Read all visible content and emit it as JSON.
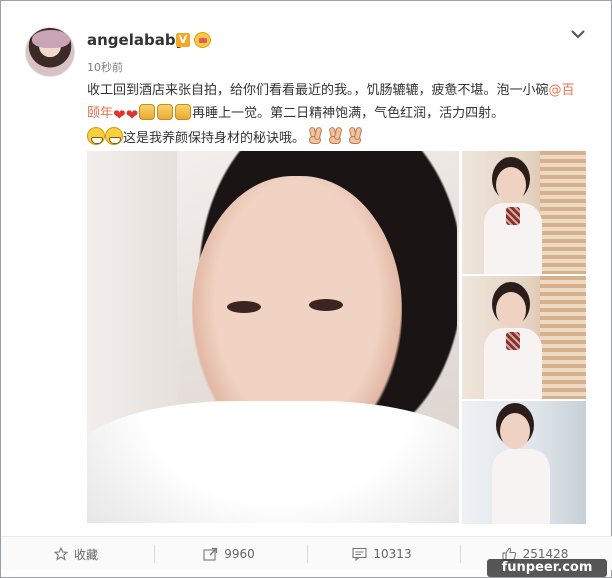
{
  "post": {
    "username": "angelababy",
    "verified_badge": "V",
    "time": "10秒前",
    "text": {
      "part1": "收工回到酒店来张自拍，给你们看看最近的我。，饥肠辘辘，疲惫不堪。泡一小碗",
      "mention": "@百颐年",
      "part2": "再睡上一觉。第二日精神饱满，气色红润，活力四射。",
      "part3": "这是我养颜保持身材的秘诀哦。"
    },
    "emoji": [
      "heart",
      "heart",
      "thumbs-up",
      "thumbs-up",
      "thumbs-up",
      "grin",
      "grin",
      "peace",
      "peace",
      "peace"
    ],
    "colors": {
      "mention": "#eb7350",
      "verified": "#f5a623",
      "text": "#333333",
      "muted": "#808080"
    }
  },
  "actions": {
    "favorite": {
      "label": "收藏",
      "icon": "star-icon"
    },
    "share": {
      "count": "9960",
      "icon": "share-icon"
    },
    "comment": {
      "count": "10313",
      "icon": "comment-icon"
    },
    "like": {
      "count": "251428",
      "icon": "thumbs-up-icon"
    }
  },
  "watermark": "funpeer.com"
}
